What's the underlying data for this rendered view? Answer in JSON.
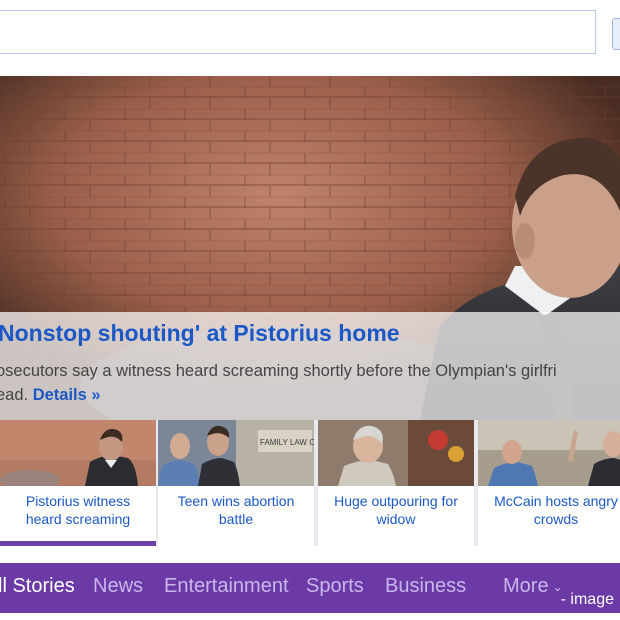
{
  "search": {
    "placeholder": "",
    "value": ""
  },
  "hero": {
    "title": "Nonstop shouting' at Pistorius home",
    "summary_line1": "osecutors say a witness heard screaming shortly before the Olympian's girlfri",
    "summary_line2_prefix": "ead. ",
    "details_label": "Details »"
  },
  "thumbnails": [
    {
      "line1": "Pistorius witness",
      "line2": "heard screaming",
      "active": true
    },
    {
      "line1": "Teen wins abortion",
      "line2": "battle",
      "active": false
    },
    {
      "line1": "Huge outpouring for",
      "line2": "widow",
      "active": false
    },
    {
      "line1": "McCain hosts angry",
      "line2": "crowds",
      "active": false
    }
  ],
  "thumb2_sign": "FAMILY LAW CENTER",
  "categories": [
    {
      "label": "ll Stories",
      "active": true
    },
    {
      "label": "News",
      "active": false
    },
    {
      "label": "Entertainment",
      "active": false
    },
    {
      "label": "Sports",
      "active": false
    },
    {
      "label": "Business",
      "active": false
    },
    {
      "label": "More",
      "active": false
    }
  ],
  "more_chevron": "⌄",
  "credit": "- image",
  "colors": {
    "link": "#1b58c6",
    "nav_bg": "#6b3aa6",
    "nav_text": "#c9b6ea",
    "active_bar": "#6f3fa8"
  }
}
